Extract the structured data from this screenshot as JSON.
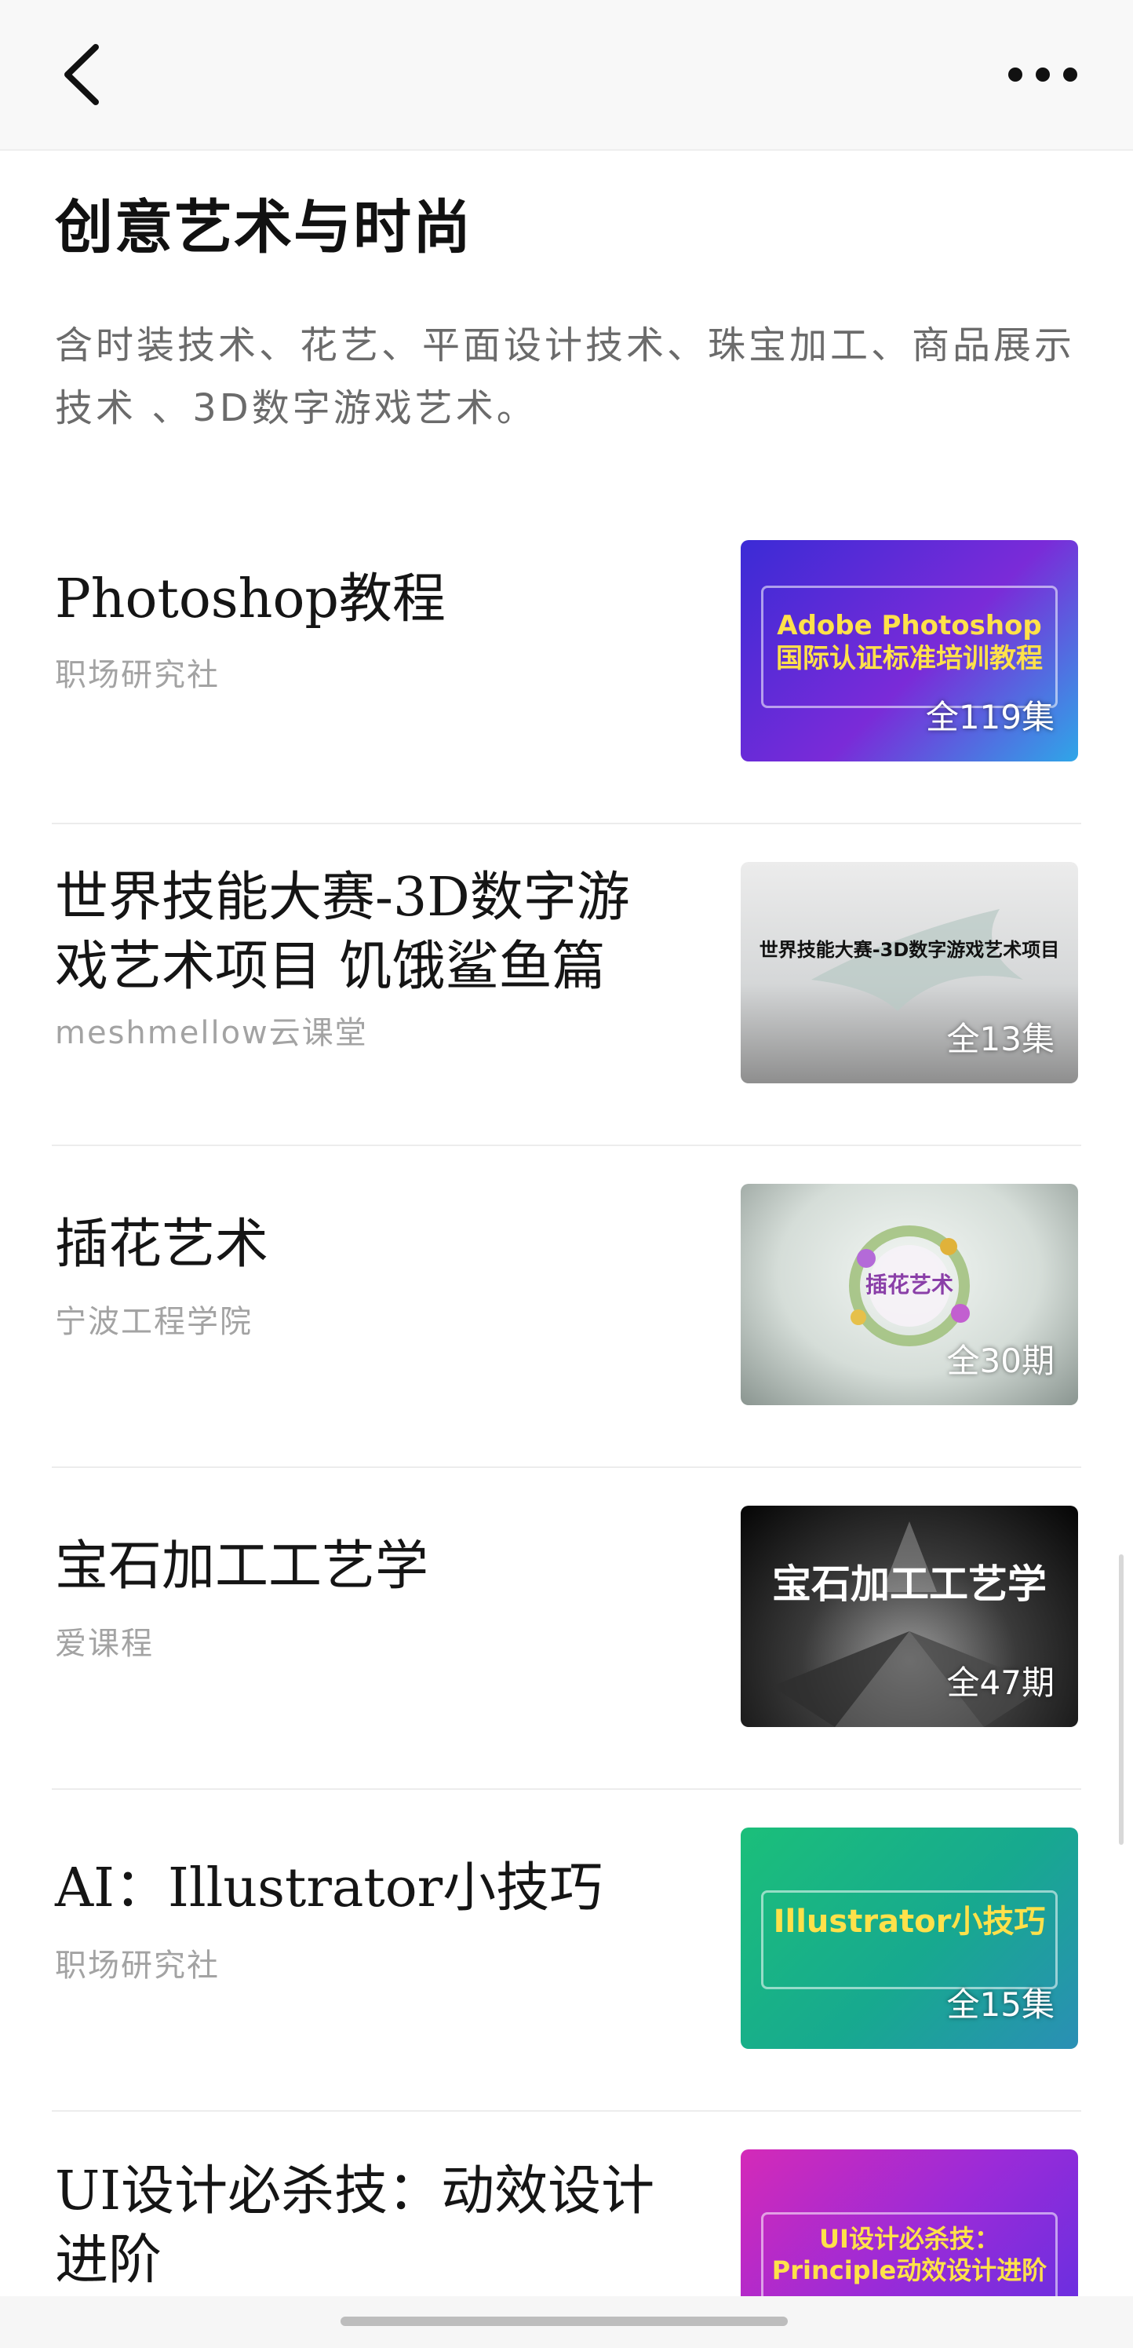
{
  "nav": {
    "back_icon": "chevron-left-icon",
    "more_icon": "more-horizontal-icon"
  },
  "header": {
    "title": "创意艺术与时尚",
    "description": "含时装技术、花艺、平面设计技术、珠宝加工、商品展示技术 、3D数字游戏艺术。"
  },
  "courses": [
    {
      "title": "Photoshop教程",
      "source": "职场研究社",
      "episodes": "全119集",
      "thumb_caption": "Adobe Photoshop\n国际认证标准培训教程",
      "thumb_colors": [
        "#3b2bd6",
        "#7a2bd8",
        "#2fa6e8"
      ]
    },
    {
      "title": "世界技能大赛-3D数字游戏艺术项目 饥饿鲨鱼篇",
      "source": "meshmellow云课堂",
      "episodes": "全13集",
      "thumb_caption": "世界技能大赛-3D数字游戏艺术项目",
      "thumb_colors": [
        "#e6e6e6",
        "#cfd2d3",
        "#9a9a9a"
      ]
    },
    {
      "title": "插花艺术",
      "source": "宁波工程学院",
      "episodes": "全30期",
      "thumb_caption": "插花艺术",
      "thumb_colors": [
        "#eef3ef",
        "#c9d2cc",
        "#7f8a85"
      ]
    },
    {
      "title": "宝石加工工艺学",
      "source": "爱课程",
      "episodes": "全47期",
      "thumb_caption": "宝石加工工艺学",
      "thumb_colors": [
        "#0a0a0a",
        "#3b3b3b",
        "#8f8f8f"
      ]
    },
    {
      "title": "AI：Illustrator小技巧",
      "source": "职场研究社",
      "episodes": "全15集",
      "thumb_caption": "Illustrator小技巧",
      "thumb_colors": [
        "#1bbf7a",
        "#17a98f",
        "#2a8fb5"
      ]
    },
    {
      "title": "UI设计必杀技：动效设计进阶",
      "source": "",
      "episodes": "",
      "thumb_caption": "UI设计必杀技：\nPrinciple动效设计进阶",
      "thumb_colors": [
        "#d42ab8",
        "#9a2bd8",
        "#6a2fe0"
      ]
    }
  ]
}
